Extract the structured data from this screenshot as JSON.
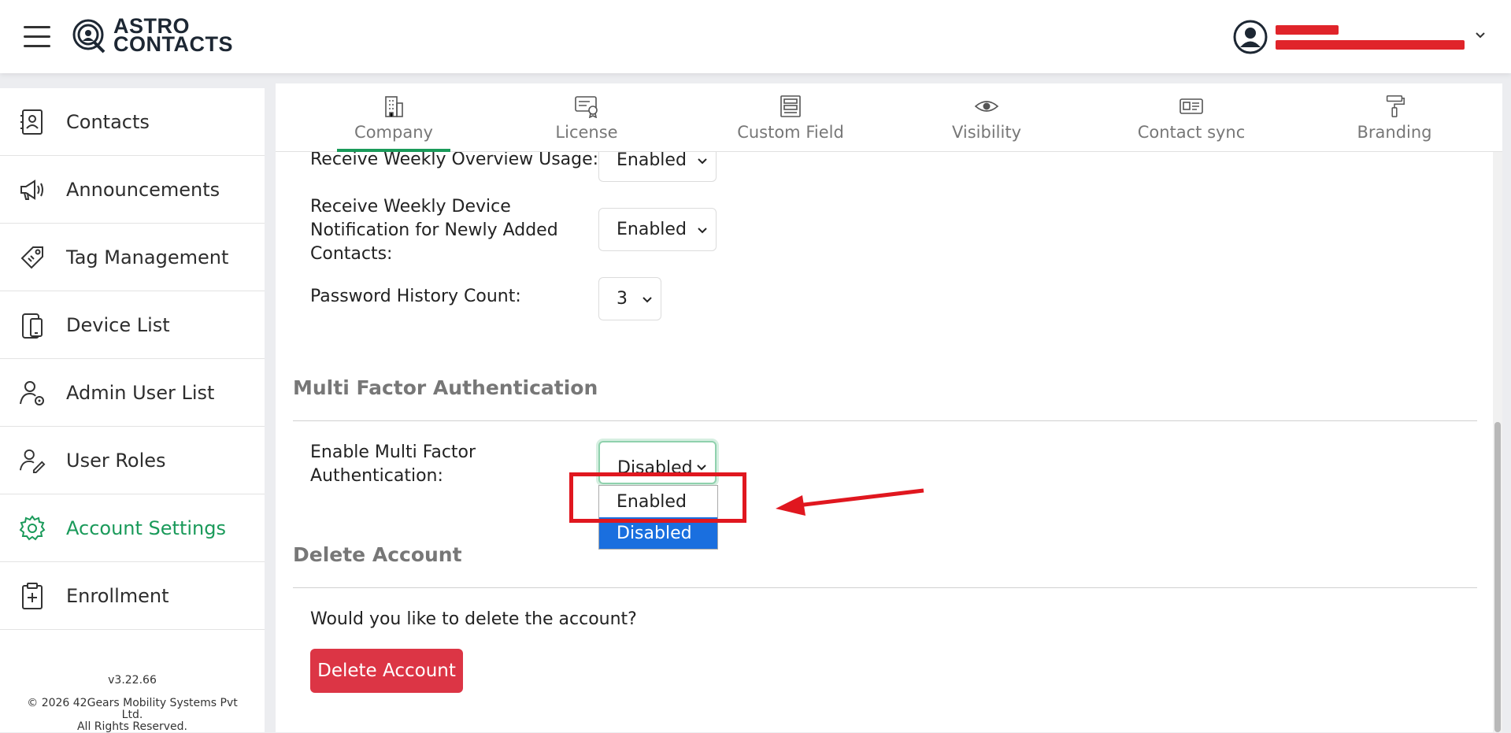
{
  "header": {
    "logo_line1": "ASTRO",
    "logo_line2": "CONTACTS"
  },
  "sidebar": {
    "items": [
      {
        "label": "Contacts",
        "icon": "contacts-icon"
      },
      {
        "label": "Announcements",
        "icon": "megaphone-icon"
      },
      {
        "label": "Tag Management",
        "icon": "tag-icon"
      },
      {
        "label": "Device List",
        "icon": "device-icon"
      },
      {
        "label": "Admin User List",
        "icon": "admin-user-icon"
      },
      {
        "label": "User Roles",
        "icon": "user-role-icon"
      },
      {
        "label": "Account Settings",
        "icon": "gear-icon"
      },
      {
        "label": "Enrollment",
        "icon": "enrollment-icon"
      }
    ],
    "version": "v3.22.66",
    "copyright_line1": "© 2026 42Gears Mobility Systems Pvt",
    "copyright_line2": "Ltd.",
    "copyright_line3": "All Rights Reserved."
  },
  "tabs": [
    {
      "label": "Company",
      "icon": "building-icon"
    },
    {
      "label": "License",
      "icon": "certificate-icon"
    },
    {
      "label": "Custom Field",
      "icon": "form-icon"
    },
    {
      "label": "Visibility",
      "icon": "eye-icon"
    },
    {
      "label": "Contact sync",
      "icon": "id-card-icon"
    },
    {
      "label": "Branding",
      "icon": "paint-roller-icon"
    }
  ],
  "settings": {
    "weekly_overview_label": "Receive Weekly Overview Usage:",
    "weekly_overview_value": "Enabled",
    "weekly_device_label_1": "Receive Weekly Device",
    "weekly_device_label_2": "Notification for Newly Added",
    "weekly_device_label_3": "Contacts:",
    "weekly_device_value": "Enabled",
    "password_history_label": "Password History Count:",
    "password_history_value": "3"
  },
  "mfa": {
    "section_title": "Multi Factor Authentication",
    "label_1": "Enable Multi Factor",
    "label_2": "Authentication:",
    "value": "Disabled",
    "options": [
      "Enabled",
      "Disabled"
    ]
  },
  "delete": {
    "section_title": "Delete Account",
    "question": "Would you like to delete the account?",
    "button_label": "Delete Account"
  },
  "colors": {
    "accent": "#1a9a5a",
    "danger": "#dc3545",
    "selection": "#1a6fdf",
    "annotation": "#e0171f"
  }
}
